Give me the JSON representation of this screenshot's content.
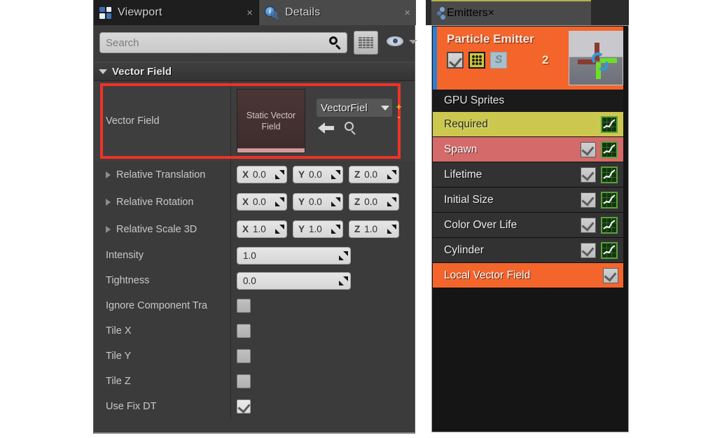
{
  "details_panel": {
    "tabs": [
      {
        "label": "Viewport",
        "icon": "viewport-grid-icon",
        "active": false,
        "close": "×"
      },
      {
        "label": "Details",
        "icon": "details-info-icon",
        "active": true,
        "close": "×"
      }
    ],
    "search": {
      "value": "",
      "placeholder": "Search",
      "icon": "search-icon"
    },
    "view_options_icon": "grid-view-icon",
    "eye_icon": "eye-icon",
    "eye_chevron_icon": "chevron-down-icon",
    "section": {
      "title": "Vector Field",
      "expanded": true
    },
    "asset_row": {
      "label": "Vector Field",
      "thumbnail_label": "Static Vector Field",
      "combo_value": "VectorFiel",
      "combo_chevron_icon": "chevron-down-icon",
      "back_icon": "arrow-left-icon",
      "browse_icon": "search-icon",
      "plus_label": "+",
      "minus_label": "-",
      "highlight_color": "#f03127"
    },
    "vector_rows": [
      {
        "label": "Relative Translation",
        "expandable": true,
        "fields": [
          {
            "axis": "X",
            "value": "0.0"
          },
          {
            "axis": "Y",
            "value": "0.0"
          },
          {
            "axis": "Z",
            "value": "0.0"
          }
        ]
      },
      {
        "label": "Relative Rotation",
        "expandable": true,
        "fields": [
          {
            "axis": "X",
            "value": "0.0"
          },
          {
            "axis": "Y",
            "value": "0.0"
          },
          {
            "axis": "Z",
            "value": "0.0"
          }
        ]
      },
      {
        "label": "Relative Scale 3D",
        "expandable": true,
        "fields": [
          {
            "axis": "X",
            "value": "1.0"
          },
          {
            "axis": "Y",
            "value": "1.0"
          },
          {
            "axis": "Z",
            "value": "1.0"
          }
        ]
      }
    ],
    "scalar_rows": [
      {
        "label": "Intensity",
        "value": "1.0"
      },
      {
        "label": "Tightness",
        "value": "0.0"
      }
    ],
    "checkbox_rows": [
      {
        "label": "Ignore Component Tra",
        "checked": false
      },
      {
        "label": "Tile X",
        "checked": false
      },
      {
        "label": "Tile Y",
        "checked": false
      },
      {
        "label": "Tile Z",
        "checked": false
      },
      {
        "label": "Use Fix DT",
        "checked": true
      }
    ]
  },
  "emitters_panel": {
    "tab": {
      "label": "Emitters",
      "icon": "emitter-particles-icon",
      "close": "×"
    },
    "emitter": {
      "title": "Particle Emitter",
      "count": "2",
      "enabled_icon": "checkbox-checked-icon",
      "particles_icon": "particle-dots-icon",
      "solo_icon": "solo-s-icon",
      "thumbnail_icon": "emitter-preview-thumbnail",
      "accent_color": "#f4652c",
      "selection_bar_color": "#2f7fd0"
    },
    "type_row": {
      "label": "GPU Sprites"
    },
    "modules": [
      {
        "label": "Required",
        "bg": "#ccc84f",
        "text": "#2a2a14",
        "checkbox": false,
        "graph": true
      },
      {
        "label": "Spawn",
        "bg": "#d46a6a",
        "text": "#ffffff",
        "checkbox": true,
        "graph": true
      },
      {
        "label": "Lifetime",
        "bg": "#323232",
        "text": "#ececec",
        "checkbox": true,
        "graph": true
      },
      {
        "label": "Initial Size",
        "bg": "#323232",
        "text": "#ececec",
        "checkbox": true,
        "graph": true
      },
      {
        "label": "Color Over Life",
        "bg": "#323232",
        "text": "#ececec",
        "checkbox": true,
        "graph": true
      },
      {
        "label": "Cylinder",
        "bg": "#323232",
        "text": "#ececec",
        "checkbox": true,
        "graph": true
      },
      {
        "label": "Local Vector Field",
        "bg": "#f4652c",
        "text": "#ffffff",
        "checkbox": true,
        "graph": false
      }
    ]
  }
}
